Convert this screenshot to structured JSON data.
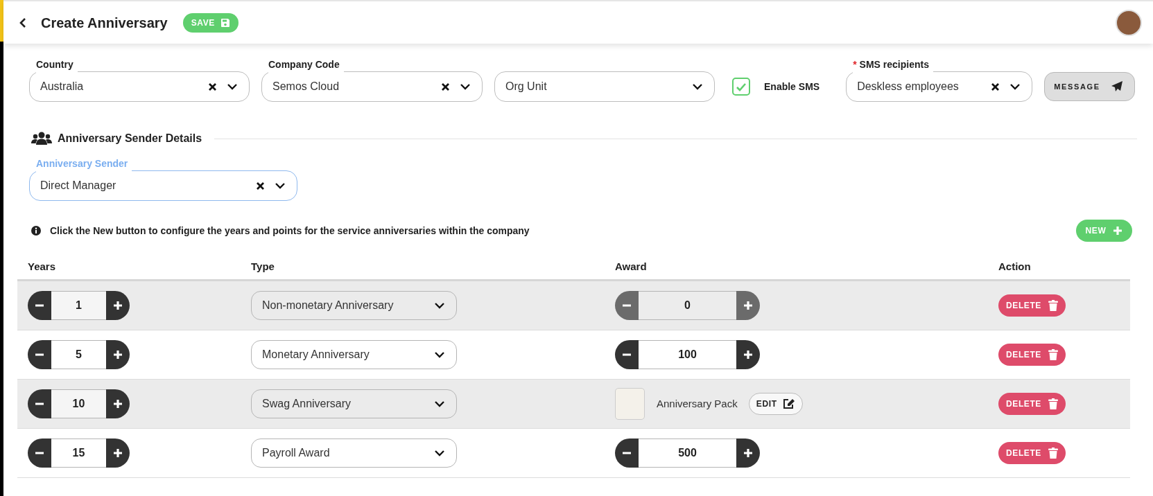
{
  "header": {
    "title": "Create Anniversary",
    "save_button": "SAVE"
  },
  "filters": [
    {
      "label": "Country",
      "value": "Australia"
    },
    {
      "label": "Company Code",
      "value": "Semos Cloud"
    },
    {
      "placeholder": "Org Unit"
    }
  ],
  "enable_sms": {
    "label": "Enable SMS",
    "checked": true
  },
  "sms_recipients": {
    "required_mark": "*",
    "label": "SMS recipients",
    "value": "Deskless employees"
  },
  "message_button": "MESSAGE",
  "sender_section": {
    "heading": "Anniversary Sender Details",
    "field": {
      "label": "Anniversary Sender",
      "value": "Direct Manager",
      "focused": true
    }
  },
  "info": "Click the New button to configure the years and points for the service anniversaries within the company",
  "new_button": "NEW",
  "table": {
    "columns": [
      "Years",
      "Type",
      "Award",
      "Action"
    ],
    "rows": [
      {
        "years": "1",
        "type": "Non-monetary Anniversary",
        "award": {
          "kind": "points",
          "value": "0",
          "disabled": true
        },
        "action": "DELETE"
      },
      {
        "years": "5",
        "type": "Monetary Anniversary",
        "award": {
          "kind": "points",
          "value": "100",
          "disabled": false
        },
        "action": "DELETE"
      },
      {
        "years": "10",
        "type": "Swag Anniversary",
        "award": {
          "kind": "swag",
          "name": "Anniversary Pack",
          "edit_button": "EDIT"
        },
        "action": "DELETE"
      },
      {
        "years": "15",
        "type": "Payroll Award",
        "award": {
          "kind": "points",
          "value": "500",
          "disabled": false
        },
        "action": "DELETE"
      }
    ]
  }
}
